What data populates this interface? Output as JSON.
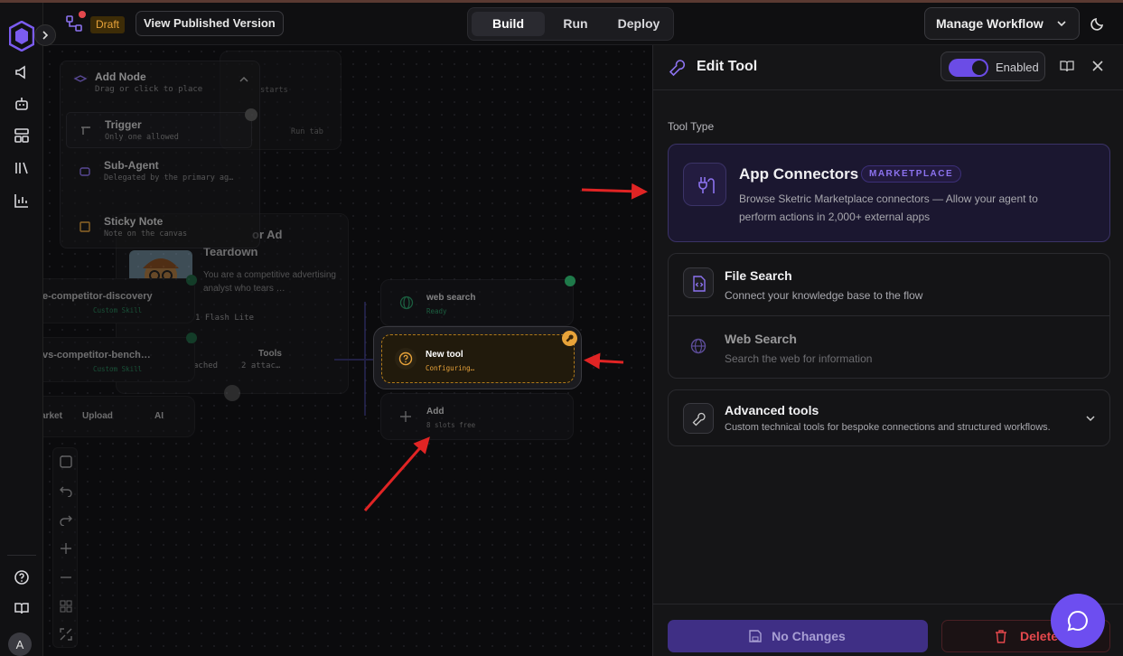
{
  "header": {
    "draft_badge": "Draft",
    "view_published": "View Published Version",
    "mode_tabs": [
      "Build",
      "Run",
      "Deploy"
    ],
    "active_tab": "Build",
    "manage_workflow": "Manage Workflow"
  },
  "sidebar": {
    "avatar_initial": "A",
    "icons": [
      "megaphone-icon",
      "bot-icon",
      "layout-icon",
      "library-icon",
      "chart-icon",
      "help-icon",
      "book-icon"
    ]
  },
  "add_node_panel": {
    "title": "Add Node",
    "subtitle": "Drag or click to place",
    "items": [
      {
        "title": "Trigger",
        "subtitle": "Only one allowed"
      },
      {
        "title": "Sub-Agent",
        "subtitle": "Delegated by the primary ag…"
      },
      {
        "title": "Sticky Note",
        "subtitle": "Note on the canvas"
      }
    ],
    "behind_text_1": "starts",
    "behind_text_2": "Run tab"
  },
  "canvas": {
    "agent_card": {
      "title_fragment": "or Ad",
      "title_line2": "Teardown",
      "desc": "You are a competitive advertising analyst who tears …",
      "model": "1 Flash Lite",
      "attached": "ached",
      "tools_label": "Tools",
      "tools_count": "2 attac…"
    },
    "skill_1": {
      "name": "e-competitor-discovery",
      "tag": "Custom Skill"
    },
    "skill_2": {
      "name": "vs-competitor-bench…",
      "tag": "Custom Skill"
    },
    "actions": [
      "arket",
      "Upload",
      "AI"
    ],
    "tool_nodes": [
      {
        "title": "web search",
        "status": "Ready"
      },
      {
        "title": "New tool",
        "status": "Configuring…"
      },
      {
        "title": "Add",
        "status": "8 slots free"
      }
    ]
  },
  "edit_tool": {
    "title": "Edit Tool",
    "toggle_label": "Enabled",
    "toggle_on": true,
    "section_label": "Tool Type",
    "options": [
      {
        "title": "App Connectors",
        "badge": "MARKETPLACE",
        "desc": "Browse Sketric Marketplace connectors — Allow your agent to perform actions in 2,000+ external apps",
        "selected": true
      },
      {
        "title": "File Search",
        "desc": "Connect your knowledge base to the flow"
      },
      {
        "title": "Web Search",
        "desc": "Search the web for information"
      },
      {
        "title": "Advanced tools",
        "desc": "Custom technical tools for bespoke connections and structured workflows."
      }
    ],
    "save_button": "No Changes",
    "delete_button": "Delete"
  },
  "colors": {
    "accent": "#6d4ef0",
    "draft": "#e8a33a",
    "danger": "#e5484d",
    "success": "#1f7a4a",
    "annotation_arrow": "#e02424"
  }
}
